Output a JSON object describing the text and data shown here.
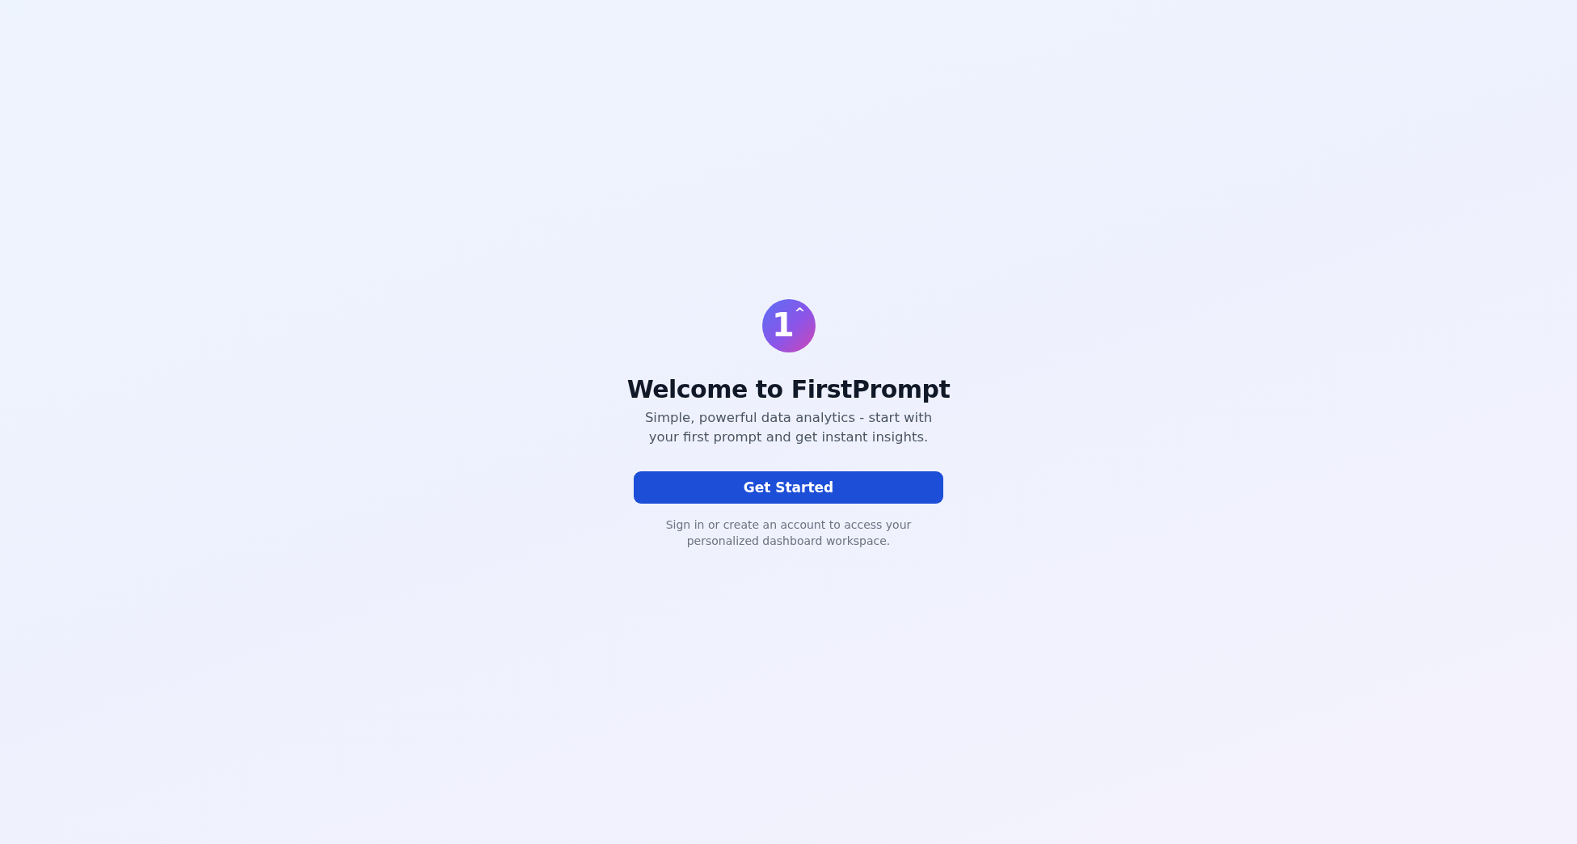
{
  "logo": {
    "digit": "1",
    "mark": "^"
  },
  "title": "Welcome to FirstPrompt",
  "subtitle": "Simple, powerful data analytics - start with your first prompt and get instant insights.",
  "primary_button": {
    "label": "Get Started"
  },
  "footnote": "Sign in or create an account to access your personalized dashboard workspace."
}
